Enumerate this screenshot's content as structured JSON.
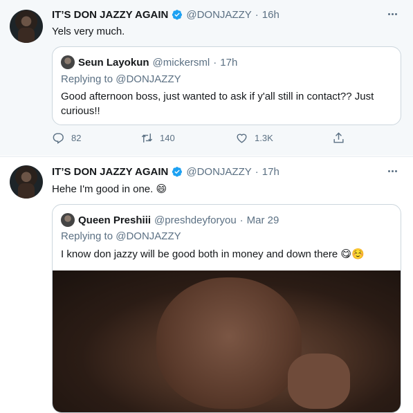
{
  "tweets": [
    {
      "author_name": "IT’S DON JAZZY AGAIN",
      "handle": "@DONJAZZY",
      "separator": "·",
      "time": "16h",
      "text": "Yels very much.",
      "quoted": {
        "author_name": "Seun Layokun",
        "handle": "@mickersml",
        "separator": "·",
        "time": "17h",
        "replying_prefix": "Replying to ",
        "replying_to": "@DONJAZZY",
        "text": "Good afternoon boss, just wanted to ask if y'all still in contact?? Just curious!!"
      },
      "actions": {
        "replies": "82",
        "retweets": "140",
        "likes": "1.3K"
      }
    },
    {
      "author_name": "IT’S DON JAZZY AGAIN",
      "handle": "@DONJAZZY",
      "separator": "·",
      "time": "17h",
      "text": "Hehe I'm good in one.",
      "text_emoji": "😄",
      "quoted": {
        "author_name": "Queen Preshiii",
        "handle": "@preshdeyforyou",
        "separator": "·",
        "time": "Mar 29",
        "replying_prefix": "Replying to ",
        "replying_to": "@DONJAZZY",
        "text": "I know don jazzy will be good both in money and down there",
        "text_emojis": "😋☺️"
      }
    }
  ],
  "icons": {
    "verified": "verified-badge-icon",
    "more": "more-options-icon",
    "reply": "reply-icon",
    "retweet": "retweet-icon",
    "like": "like-icon",
    "share": "share-icon"
  },
  "colors": {
    "verified": "#1da1f2",
    "muted": "#5b7083",
    "text": "#14171a"
  }
}
